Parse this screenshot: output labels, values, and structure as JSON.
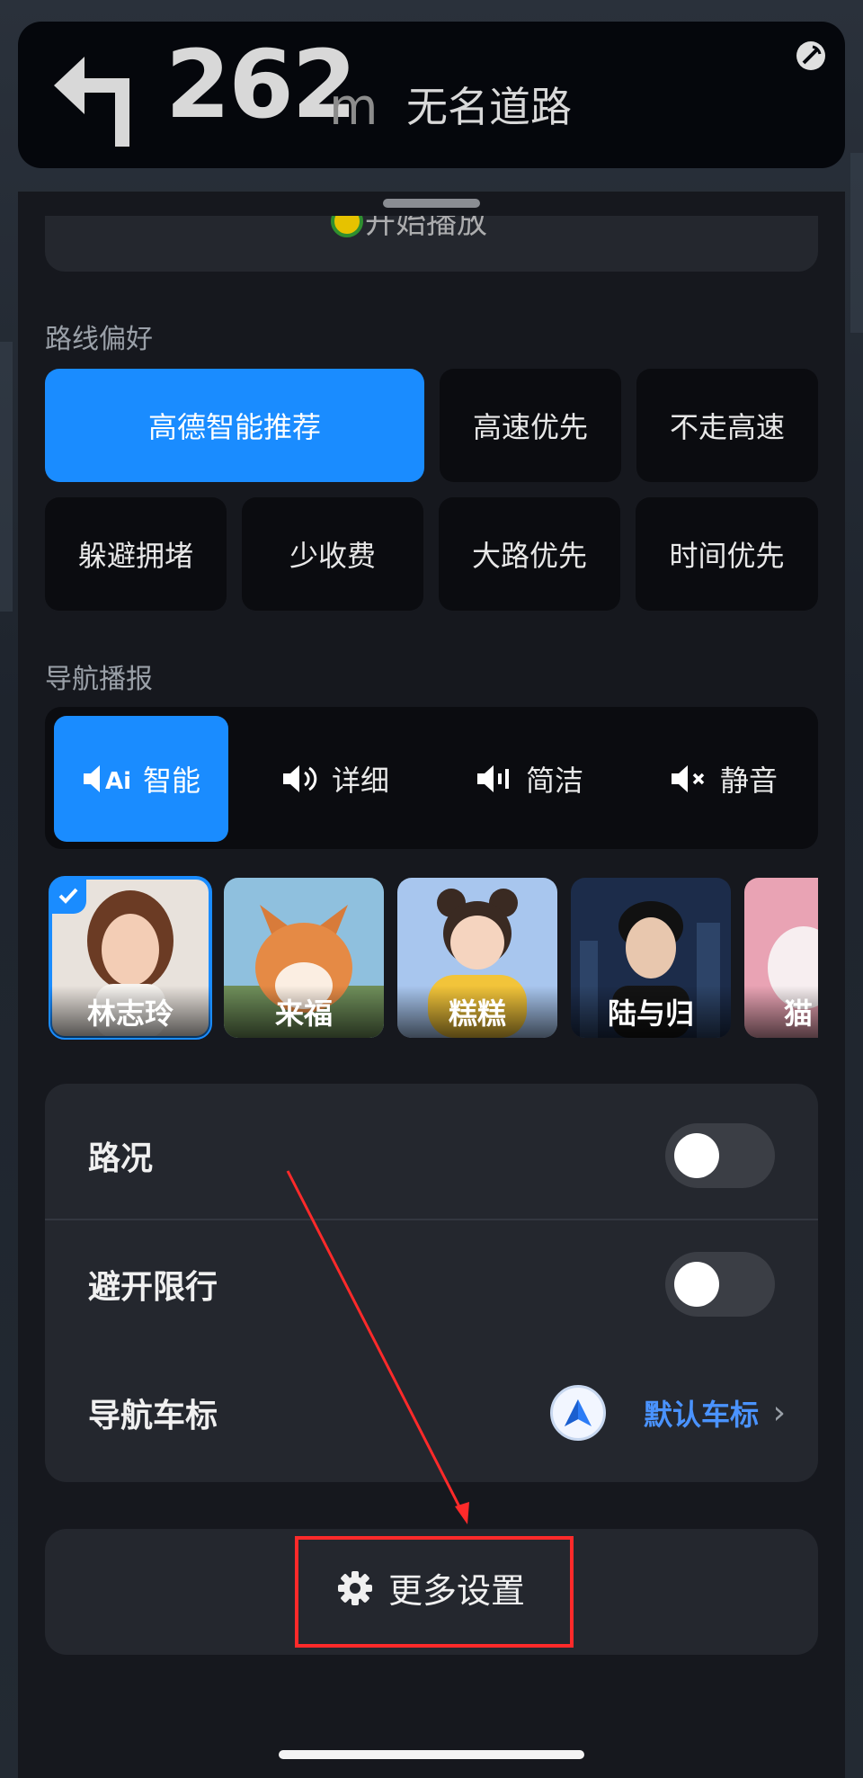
{
  "nav_banner": {
    "distance": "262",
    "unit": "m",
    "road_name": "无名道路",
    "turn_icon": "turn-left-icon",
    "gps_icon": "gps-signal-icon"
  },
  "top_card": {
    "text": "开始播放"
  },
  "route_preferences": {
    "title": "路线偏好",
    "options": [
      "高德智能推荐",
      "高速优先",
      "不走高速",
      "躲避拥堵",
      "少收费",
      "大路优先",
      "时间优先"
    ],
    "selected": "高德智能推荐"
  },
  "voice_broadcast": {
    "title": "导航播报",
    "modes": [
      {
        "label": "智能",
        "icon": "speaker-ai-icon"
      },
      {
        "label": "详细",
        "icon": "speaker-loud-icon"
      },
      {
        "label": "简洁",
        "icon": "speaker-brief-icon"
      },
      {
        "label": "静音",
        "icon": "speaker-mute-icon"
      }
    ],
    "selected": "智能"
  },
  "voices": [
    {
      "name": "林志玲",
      "selected": true
    },
    {
      "name": "来福",
      "selected": false
    },
    {
      "name": "糕糕",
      "selected": false
    },
    {
      "name": "陆与归",
      "selected": false
    },
    {
      "name": "猫",
      "selected": false
    }
  ],
  "settings": {
    "traffic": {
      "label": "路况",
      "on": false
    },
    "avoid_restriction": {
      "label": "避开限行",
      "on": false
    },
    "vehicle_icon": {
      "label": "导航车标",
      "value": "默认车标"
    }
  },
  "more_settings": {
    "label": "更多设置",
    "icon": "gear-icon"
  },
  "colors": {
    "accent": "#1a8cff",
    "annotation": "#ff2a2a",
    "link": "#4a93ff"
  }
}
